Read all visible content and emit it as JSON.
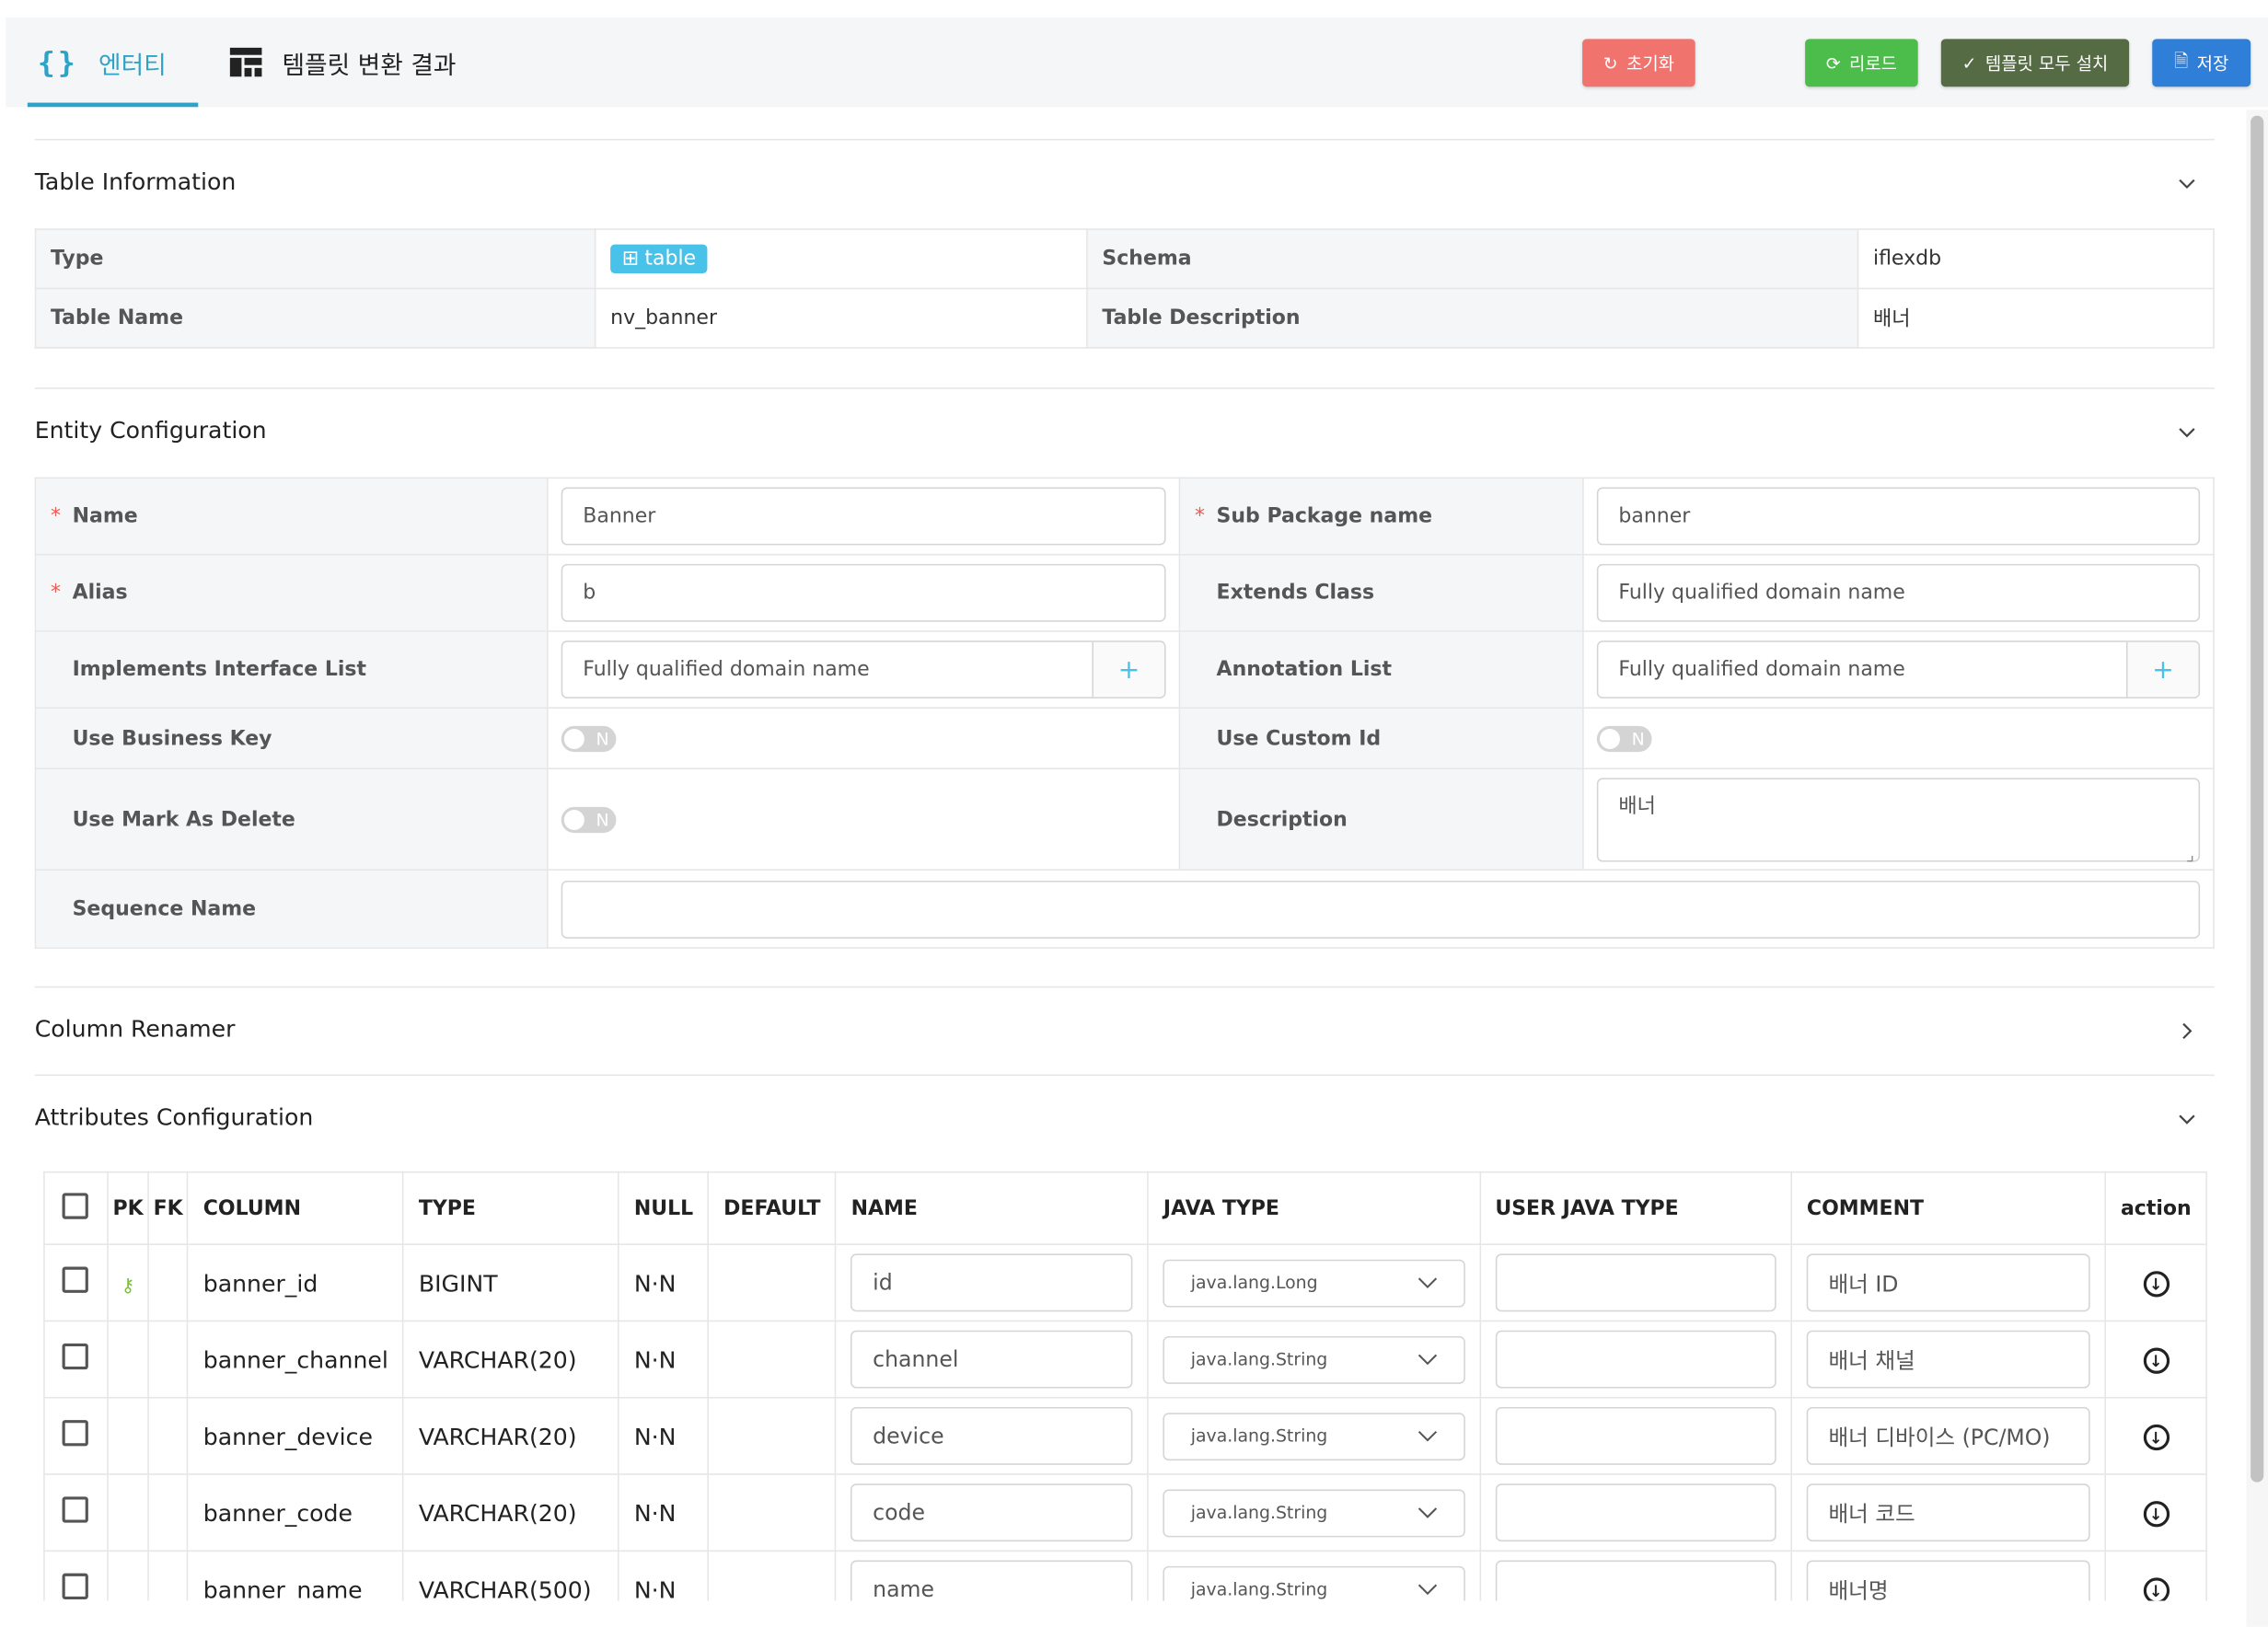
{
  "tabs": [
    {
      "label": "엔터티",
      "icon": "braces-icon",
      "active": true
    },
    {
      "label": "템플릿 변환 결과",
      "icon": "template-icon",
      "active": false
    }
  ],
  "toolbar": {
    "reset_label": "초기화",
    "reload_label": "리로드",
    "apply_all_label": "템플릿 모두 설치",
    "save_label": "저장"
  },
  "colors": {
    "accent": "#2fa3c7",
    "reset": "#f0736e",
    "reload": "#4cbc4a",
    "apply_all": "#556b44",
    "save": "#2f7ed8",
    "badge": "#48c2e8"
  },
  "table_info": {
    "title": "Table Information",
    "type_label": "Type",
    "type_value": "table",
    "schema_label": "Schema",
    "schema_value": "iflexdb",
    "table_name_label": "Table Name",
    "table_name_value": "nv_banner",
    "table_desc_label": "Table Description",
    "table_desc_value": "배너"
  },
  "entity_config": {
    "title": "Entity Configuration",
    "name_label": "Name",
    "name_value": "Banner",
    "sub_package_label": "Sub Package name",
    "sub_package_value": "banner",
    "alias_label": "Alias",
    "alias_value": "b",
    "extends_label": "Extends Class",
    "extends_placeholder": "Fully qualified domain name",
    "implements_label": "Implements Interface List",
    "implements_placeholder": "Fully qualified domain name",
    "annotation_label": "Annotation List",
    "annotation_placeholder": "Fully qualified domain name",
    "business_key_label": "Use Business Key",
    "business_key_value": "N",
    "custom_id_label": "Use Custom Id",
    "custom_id_value": "N",
    "mark_delete_label": "Use Mark As Delete",
    "mark_delete_value": "N",
    "description_label": "Description",
    "description_value": "배너",
    "sequence_label": "Sequence Name",
    "sequence_value": ""
  },
  "column_renamer": {
    "title": "Column Renamer"
  },
  "attributes": {
    "title": "Attributes Configuration",
    "headers": [
      "PK",
      "FK",
      "COLUMN",
      "TYPE",
      "NULL",
      "DEFAULT",
      "NAME",
      "JAVA TYPE",
      "USER JAVA TYPE",
      "COMMENT",
      "action"
    ],
    "rows": [
      {
        "pk": true,
        "column": "banner_id",
        "type": "BIGINT",
        "null": "N·N",
        "default": "",
        "name": "id",
        "java_type": "java.lang.Long",
        "user_java_type": "",
        "comment": "배너 ID"
      },
      {
        "pk": false,
        "column": "banner_channel",
        "type": "VARCHAR(20)",
        "null": "N·N",
        "default": "",
        "name": "channel",
        "java_type": "java.lang.String",
        "user_java_type": "",
        "comment": "배너 채널"
      },
      {
        "pk": false,
        "column": "banner_device",
        "type": "VARCHAR(20)",
        "null": "N·N",
        "default": "",
        "name": "device",
        "java_type": "java.lang.String",
        "user_java_type": "",
        "comment": "배너 디바이스 (PC/MO)"
      },
      {
        "pk": false,
        "column": "banner_code",
        "type": "VARCHAR(20)",
        "null": "N·N",
        "default": "",
        "name": "code",
        "java_type": "java.lang.String",
        "user_java_type": "",
        "comment": "배너 코드"
      },
      {
        "pk": false,
        "column": "banner_name",
        "type": "VARCHAR(500)",
        "null": "N·N",
        "default": "",
        "name": "name",
        "java_type": "java.lang.String",
        "user_java_type": "",
        "comment": "배너명"
      }
    ]
  }
}
